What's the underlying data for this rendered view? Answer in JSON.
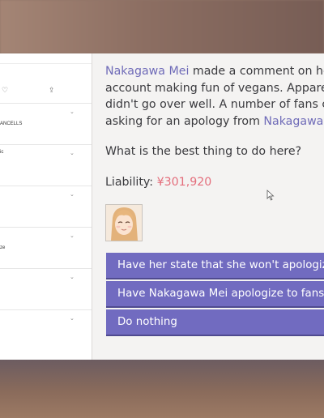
{
  "feed": {
    "rows": [
      {
        "snippet": "ANCELLS"
      },
      {
        "snippet": "ic"
      },
      {
        "snippet": ""
      },
      {
        "snippet": "ze"
      },
      {
        "snippet": ""
      },
      {
        "snippet": ""
      }
    ]
  },
  "dialog": {
    "story_lines": [
      {
        "name": "Nakagawa Mei",
        "text": " made a comment on he"
      },
      {
        "name": "",
        "text": "account making fun of vegans. Appare"
      },
      {
        "name": "",
        "text": "didn't go over well. A number of fans c"
      },
      {
        "name": "",
        "text": "asking for an apology from ",
        "trailing_name": "Nakagawa"
      }
    ],
    "question": "What is the best thing to do here?",
    "liability_label": "Liability:",
    "liability_amount": "¥301,920",
    "choices": [
      "Have her state that she won't apologize",
      "Have Nakagawa Mei apologize to fans",
      "Do nothing"
    ]
  },
  "colors": {
    "name_accent": "#6f6bb8",
    "money_accent": "#e46e7c",
    "choice_button": "#716bc0"
  }
}
